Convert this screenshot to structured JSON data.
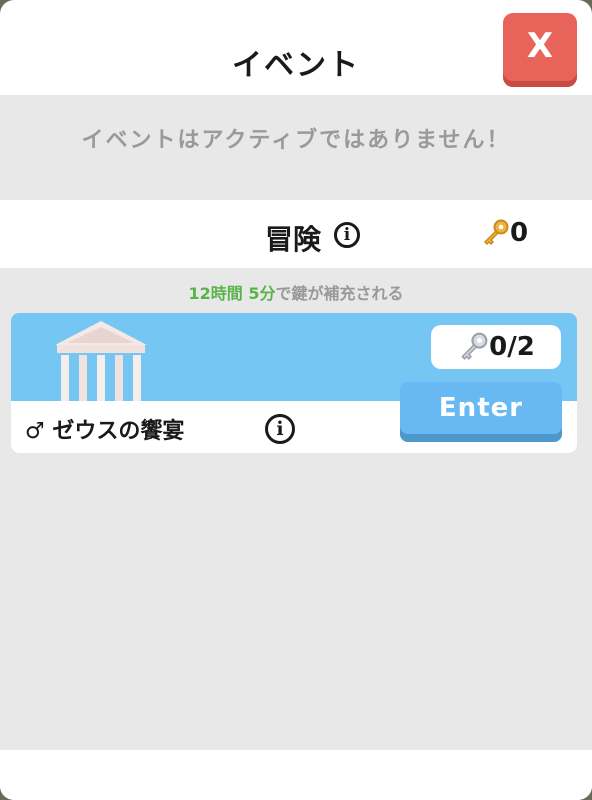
{
  "dialog": {
    "title": "イベント",
    "close_label": "X"
  },
  "notice": {
    "text": "イベントはアクティブではありません！"
  },
  "adventure": {
    "title": "冒険",
    "info_label": "i",
    "key_count": "0"
  },
  "refill": {
    "hours": "12",
    "hours_unit": "時間",
    "minutes": "5",
    "minutes_unit": "分",
    "suffix": "で鍵が補充される"
  },
  "event_card": {
    "name": "ゼウスの饗宴",
    "gender_symbol": "♂",
    "info_label": "i",
    "keys": "0/2",
    "enter_label": "Enter"
  },
  "colors": {
    "close_button": "#e8645a",
    "enter_button": "#68b9f3",
    "card_background": "#76c6f3",
    "refill_time": "#5ab34a"
  }
}
